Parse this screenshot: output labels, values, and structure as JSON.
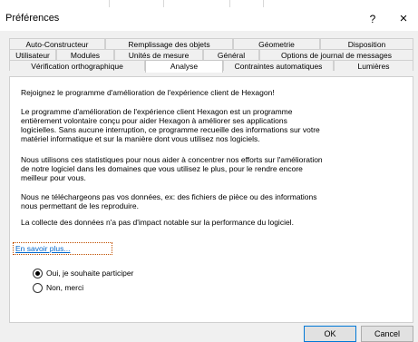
{
  "window": {
    "title": "Préférences",
    "help_label": "?",
    "close_label": "×"
  },
  "tabs": {
    "row1": [
      "Auto-Constructeur",
      "Remplissage des objets",
      "Géometrie",
      "Disposition"
    ],
    "row2": [
      "Utilisateur",
      "Modules",
      "Unités de mesure",
      "Général",
      "Options de journal de messages"
    ],
    "row3": [
      "Vérification orthographique",
      "Analyse",
      "Contraintes automatiques",
      "Lumières"
    ],
    "active": "Analyse"
  },
  "content": {
    "p1": "Rejoignez le programme d'amélioration de l'expérience client de Hexagon!",
    "p2": [
      "Le programme d'amélioration de l'expérience client Hexagon est un programme",
      "entièrement volontaire conçu pour aider Hexagon à améliorer ses applications",
      "logicielles. Sans aucune interruption, ce programme recueille des informations sur votre",
      "matériel informatique et sur la manière dont vous utilisez nos logiciels."
    ],
    "p3": [
      "Nous utilisons ces statistiques pour nous aider à concentrer nos efforts sur l'amélioration",
      "de notre logiciel dans les domaines que vous utilisez le plus, pour le rendre encore",
      "meilleur pour vous."
    ],
    "p4": [
      "Nous ne téléchargeons pas vos données, ex: des fichiers de pièce ou des informations",
      "nous permettant de les reproduire."
    ],
    "p5": "La collecte des données n'a pas d'impact notable sur la performance du logiciel.",
    "link": "En savoir plus...",
    "radio_yes": "Oui, je souhaite participer",
    "radio_no": "Non, merci",
    "selected": "yes"
  },
  "buttons": {
    "ok": "OK",
    "cancel": "Cancel"
  }
}
